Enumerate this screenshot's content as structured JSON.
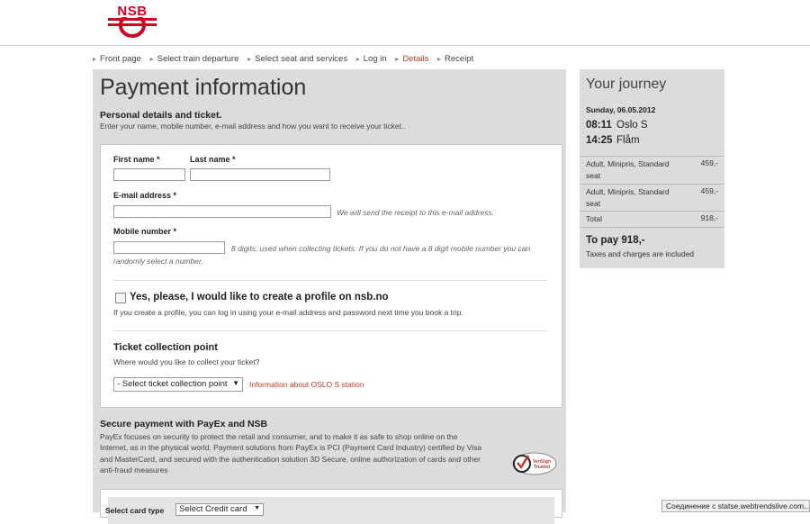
{
  "logo": {
    "text": "NSB"
  },
  "breadcrumb": [
    {
      "label": "Front page",
      "current": false
    },
    {
      "label": "Select train departure",
      "current": false
    },
    {
      "label": "Select seat and services",
      "current": false
    },
    {
      "label": "Log in",
      "current": false
    },
    {
      "label": "Details",
      "current": true
    },
    {
      "label": "Receipt",
      "current": false
    }
  ],
  "main": {
    "title": "Payment information",
    "personal_heading": "Personal details and ticket.",
    "personal_text": "Enter your name, mobile number, e-mail address and how you want to receive your ticket..",
    "form": {
      "first_name_label": "First name *",
      "first_name_value": "",
      "last_name_label": "Last name *",
      "last_name_value": "",
      "email_label": "E-mail address *",
      "email_value": "",
      "email_hint": "We will send the receipt to this e-mail address.",
      "mobile_label": "Mobile number *",
      "mobile_value": "",
      "mobile_hint_1": "8 digits, used when collecting tickets. If you do not have a 8 digit mobile number you can",
      "mobile_hint_2": "randomly select a number.",
      "profile_checked": false,
      "profile_label": "Yes, please, I would like to create a profile on nsb.no",
      "profile_text": "If you create a profile, you can log in using your e-mail address and password next time you book a trip.",
      "collection_heading": "Ticket collection point",
      "collection_question": "Where would you like to collect your ticket?",
      "collection_selected": "- Select ticket collection point",
      "collection_link": "Information about OSLO S station"
    },
    "secure": {
      "heading": "Secure payment with PayEx and NSB",
      "text": "PayEx focuses on security to protect the retail and consumer, and to make it as safe to shop online on the Internet, as in the physical world. Payment solutions from PayEx is PCI (Payment Card Industry) certified by Visa and MasterCard, and secured with the authentication solution 3D Secure, online authorization of cards and other anti-fraud measures",
      "badge_line1": "VeriSign",
      "badge_line2": "Trusted"
    },
    "card": {
      "label": "Select card type",
      "selected": "Select Credit card"
    }
  },
  "journey": {
    "title": "Your journey",
    "date": "Sunday, 06.05.2012",
    "departure_time": "08:11",
    "departure_station": "Oslo S",
    "arrival_time": "14:25",
    "arrival_station": "Flåm",
    "items": [
      {
        "desc": "Adult, Minipris, Standard seat",
        "price": "459,-"
      },
      {
        "desc": "Adult, Minipris, Standard seat",
        "price": "459,-"
      }
    ],
    "total_label": "Total",
    "total_value": "918,-",
    "to_pay": "To pay 918,-",
    "taxes": "Taxes and charges are included"
  },
  "status_bar": "Соединение с statse.webtrendslive.com...",
  "colors": {
    "brand": "#d4001f",
    "link": "#c0392b",
    "panel": "#dcdcdc"
  }
}
